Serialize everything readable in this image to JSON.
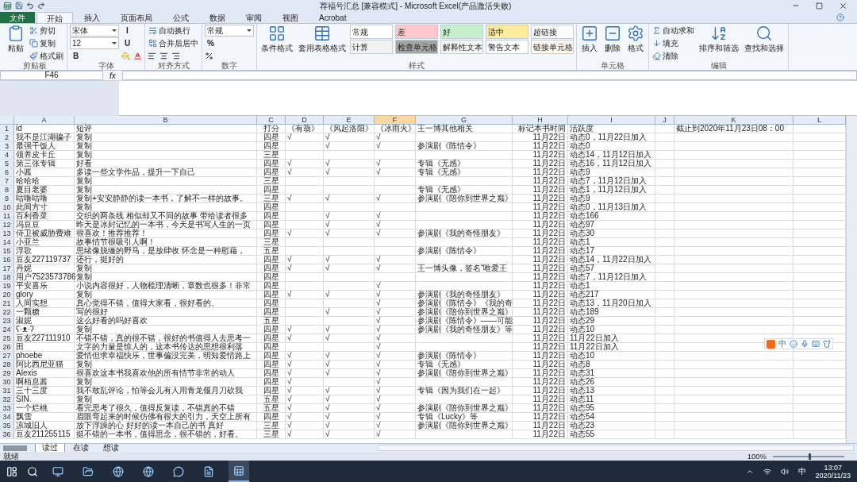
{
  "window": {
    "title": "荐福号汇总  [兼容模式] - Microsoft Excel(产品激活失败)"
  },
  "ribbon": {
    "file_tab": "文件",
    "tabs": [
      {
        "label": "开始",
        "selected": true
      },
      {
        "label": "插入",
        "selected": false
      },
      {
        "label": "页面布局",
        "selected": false
      },
      {
        "label": "公式",
        "selected": false
      },
      {
        "label": "数据",
        "selected": false
      },
      {
        "label": "审阅",
        "selected": false
      },
      {
        "label": "视图",
        "selected": false
      },
      {
        "label": "Acrobat",
        "selected": false
      }
    ],
    "groups": [
      {
        "label": "剪贴板",
        "items": [
          {
            "kind": "large",
            "label": "粘贴"
          },
          {
            "kind": "small",
            "label": "剪切"
          },
          {
            "kind": "small",
            "label": "复制"
          },
          {
            "kind": "small",
            "label": "格式刷"
          }
        ]
      },
      {
        "label": "字体",
        "items": [
          {
            "kind": "combo",
            "label": "宋体"
          },
          {
            "kind": "combo",
            "label": "12"
          },
          {
            "kind": "toggle",
            "label": "B"
          },
          {
            "kind": "toggle",
            "label": "I"
          },
          {
            "kind": "toggle",
            "label": "U"
          }
        ]
      },
      {
        "label": "对齐方式",
        "items": [
          {
            "kind": "small",
            "label": "自动换行"
          },
          {
            "kind": "small",
            "label": "合并后居中"
          }
        ]
      },
      {
        "label": "数字",
        "items": [
          {
            "kind": "combo",
            "label": "常规"
          },
          {
            "kind": "toggle",
            "label": "%"
          }
        ]
      },
      {
        "label": "样式",
        "items": [
          {
            "kind": "large",
            "label": "条件格式"
          },
          {
            "kind": "large",
            "label": "套用表格格式"
          },
          {
            "kind": "style",
            "label": "常规",
            "color": "#ffffff"
          },
          {
            "kind": "style",
            "label": "计算",
            "color": "#f2f2f2"
          },
          {
            "kind": "style",
            "label": "差",
            "color": "#ffc7ce"
          },
          {
            "kind": "style",
            "label": "检查单元格",
            "color": "#a5a5a5"
          },
          {
            "kind": "style",
            "label": "好",
            "color": "#c6efce"
          },
          {
            "kind": "style",
            "label": "解释性文本",
            "color": "#f4f4f4"
          },
          {
            "kind": "style",
            "label": "适中",
            "color": "#ffeb9c"
          },
          {
            "kind": "style",
            "label": "警告文本",
            "color": "#fdfdfd"
          },
          {
            "kind": "style",
            "label": "超链接",
            "color": "#fafafa"
          },
          {
            "kind": "style",
            "label": "链接单元格",
            "color": "#fff8ee"
          }
        ]
      },
      {
        "label": "单元格",
        "items": [
          {
            "kind": "large",
            "label": "插入"
          },
          {
            "kind": "large",
            "label": "删除"
          },
          {
            "kind": "large",
            "label": "格式"
          }
        ]
      },
      {
        "label": "编辑",
        "items": [
          {
            "kind": "small",
            "label": "自动求和"
          },
          {
            "kind": "small",
            "label": "填充"
          },
          {
            "kind": "small",
            "label": "清除"
          },
          {
            "kind": "large",
            "label": "排序和筛选"
          },
          {
            "kind": "large",
            "label": "查找和选择"
          }
        ]
      }
    ]
  },
  "formula_bar": {
    "name_box": "F46",
    "function_label": "fx"
  },
  "sheet": {
    "columns": [
      {
        "label": "A",
        "selected": false
      },
      {
        "label": "B",
        "selected": false
      },
      {
        "label": "C",
        "selected": false
      },
      {
        "label": "D",
        "selected": false
      },
      {
        "label": "E",
        "selected": false
      },
      {
        "label": "F",
        "selected": true
      },
      {
        "label": "G",
        "selected": false
      },
      {
        "label": "H",
        "selected": false
      },
      {
        "label": "I",
        "selected": false
      },
      {
        "label": "J",
        "selected": false
      },
      {
        "label": "K",
        "selected": false
      },
      {
        "label": "L",
        "selected": false
      }
    ],
    "rows": [
      {
        "n": "1",
        "a": "id",
        "b": "短评",
        "c": "打分",
        "d": "《有翡》",
        "e": "《风起洛阳》",
        "f": "《冰雨火》",
        "g": "王一博其他相关",
        "h": "标记本书时间",
        "i": "活跃度",
        "k": "截止到2020年11月23日08：00"
      },
      {
        "n": "2",
        "a": "我不是江湖骗子",
        "b": "复制",
        "c": "四星",
        "d": "√",
        "e": "√",
        "f": "√",
        "h": "11月22日",
        "i": "动态0，11月22日加入"
      },
      {
        "n": "3",
        "a": "最强干饭人",
        "b": "复制",
        "c": "四星",
        "e": "√",
        "f": "√",
        "g": "参演剧《陈情令》",
        "h": "11月22日",
        "i": "动态0"
      },
      {
        "n": "4",
        "a": "领养皮卡丘",
        "b": "复制",
        "c": "三星",
        "h": "11月22日",
        "i": "动态14，11月12日加入"
      },
      {
        "n": "5",
        "a": "第三张专辑",
        "b": "好看",
        "c": "四星",
        "d": "√",
        "e": "√",
        "f": "√",
        "g": "专辑《无感》",
        "h": "11月22日",
        "i": "动态16，11月12日加入"
      },
      {
        "n": "6",
        "a": "小酱",
        "b": "多读一些文学作品，提升一下自己",
        "c": "四星",
        "d": "√",
        "e": "√",
        "f": "√",
        "g": "专辑《无感》",
        "h": "11月22日",
        "i": "动态9"
      },
      {
        "n": "7",
        "a": "哈哈哈",
        "b": "复制",
        "c": "三星",
        "h": "11月22日",
        "i": "动态7，11月12日加入"
      },
      {
        "n": "8",
        "a": "夏目老婆",
        "b": "复制",
        "c": "四星",
        "g": "专辑《无感》",
        "h": "11月22日",
        "i": "动态1，11月12日加入"
      },
      {
        "n": "9",
        "a": "咕噜咕噜",
        "b": "复制+安安静静的读一本书，了解不一样的故事。",
        "c": "三星",
        "d": "√",
        "e": "√",
        "f": "√",
        "g": "参演剧《陪你到世界之巅》",
        "h": "11月22日",
        "i": "动态9"
      },
      {
        "n": "10",
        "a": "此间方寸",
        "b": "复制",
        "c": "四星",
        "h": "11月22日",
        "i": "动态0，11月13日加入"
      },
      {
        "n": "11",
        "a": "百利香菜",
        "b": "交织的两条线 相似却又不同的故事 带给读者很多",
        "c": "四星",
        "e": "√",
        "f": "√",
        "h": "11月22日",
        "i": "动态166"
      },
      {
        "n": "12",
        "a": "冯豆豆",
        "b": "昨天是冰封记忆的一本书，今天是书写人生的一页",
        "c": "四星",
        "e": "√",
        "f": "√",
        "h": "11月22日",
        "i": "动态97"
      },
      {
        "n": "13",
        "a": "侍卫被威胁费难",
        "b": "很喜欢！推荐推荐！",
        "c": "四星",
        "d": "√",
        "e": "√",
        "f": "√",
        "g": "参演剧《我的奇怪朋友》",
        "h": "11月22日",
        "i": "动态30"
      },
      {
        "n": "14",
        "a": "小亚兰",
        "b": "故事情节很吸引人啊！",
        "c": "三星",
        "h": "11月22日",
        "i": "动态1"
      },
      {
        "n": "15",
        "a": "浮歌",
        "b": "思绪像脱缰的野马，是放肆收 怀念是一种慰藉，",
        "c": "五星",
        "g": "参演剧《陈情令》",
        "h": "11月22日",
        "i": "动态17"
      },
      {
        "n": "16",
        "a": "豆友227119737",
        "b": "还行，挺好的",
        "c": "四星",
        "d": "√",
        "e": "√",
        "f": "√",
        "h": "11月22日",
        "i": "动态14，11月22日加入"
      },
      {
        "n": "17",
        "a": "丹妮",
        "b": "复制",
        "c": "四星",
        "d": "√",
        "e": "√",
        "f": "√",
        "g": "王一博头像，签名“唯爱王",
        "h": "11月22日",
        "i": "动态57"
      },
      {
        "n": "18",
        "a": "用户7523573786",
        "b": "复制",
        "c": "四星",
        "h": "11月22日",
        "i": "动态7，11月12日加入"
      },
      {
        "n": "19",
        "a": "平安喜乐",
        "b": "小说内容很好，人物梳理清晰，章数也很多！非常",
        "c": "四星",
        "f": "√",
        "h": "11月22日",
        "i": "动态1"
      },
      {
        "n": "20",
        "a": "glory",
        "b": "复制",
        "c": "四星",
        "d": "√",
        "e": "√",
        "f": "√",
        "g": "参演剧《我的奇怪朋友》",
        "h": "11月22日",
        "i": "动态217"
      },
      {
        "n": "21",
        "a": "人间实想",
        "b": "真心觉得不错，值得大家看，很好看的。",
        "c": "四星",
        "f": "√",
        "g": "参演剧《陈情令》《我的奇",
        "h": "11月22日",
        "i": "动态13，11月20日加入"
      },
      {
        "n": "22",
        "a": "一颗糖",
        "b": "写的很好",
        "c": "四星",
        "e": "√",
        "f": "√",
        "g": "参演剧《陪你到世界之巅》",
        "h": "11月22日",
        "i": "动态189"
      },
      {
        "n": "23",
        "a": "淑妮",
        "b": "这么好看的吗好喜欢",
        "c": "五星",
        "f": "√",
        "g": "参演剧《陈情令》——可能",
        "h": "11月22日",
        "i": "动态29"
      },
      {
        "n": "24",
        "a": "ʕ·ᴥ·ʔ",
        "b": "复制",
        "c": "四星",
        "d": "√",
        "e": "√",
        "f": "√",
        "g": "参演剧《我的奇怪朋友》等",
        "h": "11月22日",
        "i": "动态10"
      },
      {
        "n": "25",
        "a": "豆友227111910",
        "b": "不错不错，真的很不错，很好的书值得人去思考一",
        "c": "四星",
        "d": "√",
        "e": "√",
        "f": "√",
        "h": "11月22日",
        "i": "11月22日加入"
      },
      {
        "n": "26",
        "a": "田",
        "b": "文字的力量是惊人的，这本书传达的思想很利落",
        "c": "四星",
        "f": "√",
        "h": "11月22日",
        "i": "11月22日加入"
      },
      {
        "n": "27",
        "a": "phoebe",
        "b": "爱情但求幸福快乐，世事偏没完美，明知爱情路上",
        "c": "四星",
        "d": "√",
        "e": "√",
        "f": "√",
        "g": "参演剧《陈情令》",
        "h": "11月22日",
        "i": "动态10"
      },
      {
        "n": "28",
        "a": "阿比西尼亚猫",
        "b": "复制",
        "c": "四星",
        "d": "√",
        "e": "√",
        "f": "√",
        "g": "专辑《无感》",
        "h": "11月22日",
        "i": "动态8"
      },
      {
        "n": "29",
        "a": "Alexis",
        "b": "很喜欢这本书我喜欢他的所有情节非常的动人",
        "c": "四星",
        "d": "√",
        "e": "√",
        "f": "√",
        "g": "参演剧《陪你到世界之巅》",
        "h": "11月22日",
        "i": "动态31"
      },
      {
        "n": "30",
        "a": "啊栢息酱",
        "b": "复制",
        "c": "四星",
        "d": "√",
        "f": "√",
        "h": "11月22日",
        "i": "动态26"
      },
      {
        "n": "31",
        "a": "三十三度",
        "b": "我不敢乱评论，怕等会儿有人用青龙偃月刀砍我",
        "c": "四星",
        "d": "√",
        "e": "√",
        "f": "√",
        "g": "专辑《因为我们在一起》",
        "h": "11月22日",
        "i": "动态13"
      },
      {
        "n": "32",
        "a": "SIN.",
        "b": "复制",
        "c": "五星",
        "d": "√",
        "e": "√",
        "f": "√",
        "h": "11月22日",
        "i": "动态11"
      },
      {
        "n": "33",
        "a": "一个烂桃",
        "b": "看完思考了很久，值得反复读，不错真的不错",
        "c": "五星",
        "d": "√",
        "e": "√",
        "f": "√",
        "g": "参演剧《陪你到世界之巅》",
        "h": "11月22日",
        "i": "动态95"
      },
      {
        "n": "34",
        "a": "飘雪",
        "b": "眉眼弯起来的时候仿佛有很大的引力，天空上所有",
        "c": "四星",
        "d": "√",
        "e": "√",
        "f": "√",
        "g": "专辑《Lucky》等",
        "h": "11月22日",
        "i": "动态54"
      },
      {
        "n": "35",
        "a": "凉城旧人",
        "b": "放下浮躁的心 好好的读一本自己的书 真好",
        "c": "三星",
        "d": "√",
        "e": "√",
        "f": "√",
        "g": "参演剧《陪你到世界之巅》",
        "h": "11月22日",
        "i": "动态23"
      },
      {
        "n": "36",
        "a": "豆友211255115",
        "b": "挺不错的一本书，值得思念，很不错的，好看。",
        "c": "三星",
        "d": "√",
        "e": "√",
        "f": "√",
        "h": "11月22日",
        "i": "动态55"
      }
    ]
  },
  "sheet_tabs": [
    {
      "label": "读过",
      "selected": true
    },
    {
      "label": "在读",
      "selected": false
    },
    {
      "label": "想读",
      "selected": false
    }
  ],
  "ime_toolbar": {
    "mode": "中"
  },
  "status_bar": {
    "status": "就绪",
    "zoom": "100%",
    "level": 0.5
  },
  "taskbar": {
    "apps": [
      {
        "selected": false
      },
      {
        "selected": false
      },
      {
        "selected": false
      },
      {
        "selected": false
      },
      {
        "selected": false
      },
      {
        "selected": false
      },
      {
        "selected": true
      }
    ],
    "input_mode": "中",
    "time": "13:07",
    "date": "2020/11/23"
  }
}
